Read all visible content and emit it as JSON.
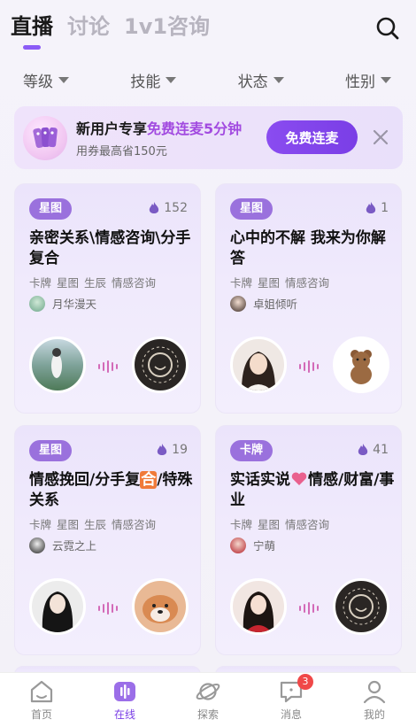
{
  "tabs": [
    {
      "label": "直播"
    },
    {
      "label": "讨论"
    },
    {
      "label": "1v1咨询"
    }
  ],
  "filters": [
    {
      "label": "等级"
    },
    {
      "label": "技能"
    },
    {
      "label": "状态"
    },
    {
      "label": "性别"
    }
  ],
  "promo": {
    "title_prefix": "新用户专享",
    "title_highlight": "免费连麦5分钟",
    "subtitle": "用券最高省150元",
    "button": "免费连麦"
  },
  "cards": [
    {
      "tag": "星图",
      "heat": "152",
      "title": "亲密关系\\情感咨询\\分手复合",
      "skills": [
        "卡牌",
        "星图",
        "生辰",
        "情感咨询"
      ],
      "host": "月华漫天"
    },
    {
      "tag": "星图",
      "heat": "1",
      "title": "心中的不解 我来为你解答",
      "skills": [
        "卡牌",
        "星图",
        "情感咨询"
      ],
      "host": "卓姐倾听"
    },
    {
      "tag": "星图",
      "heat": "19",
      "title_part1": "情感挽回/分手复",
      "title_hl": "合",
      "title_part2": "/特殊关系",
      "skills": [
        "卡牌",
        "星图",
        "生辰",
        "情感咨询"
      ],
      "host": "云霓之上"
    },
    {
      "tag": "卡牌",
      "heat": "41",
      "title_part1": "实话实说",
      "title_part2": "情感/财富/事业",
      "skills": [
        "卡牌",
        "星图",
        "情感咨询"
      ],
      "host": "宁萌"
    }
  ],
  "nav": [
    {
      "label": "首页",
      "icon": "home-icon"
    },
    {
      "label": "在线",
      "icon": "live-icon"
    },
    {
      "label": "探索",
      "icon": "planet-icon"
    },
    {
      "label": "消息",
      "icon": "message-icon",
      "badge": "3"
    },
    {
      "label": "我的",
      "icon": "profile-icon"
    }
  ],
  "colors": {
    "accent": "#7a3ee6",
    "tag_bg": "#9a71dd",
    "highlight": "#a24be0",
    "badge": "#f04848"
  }
}
